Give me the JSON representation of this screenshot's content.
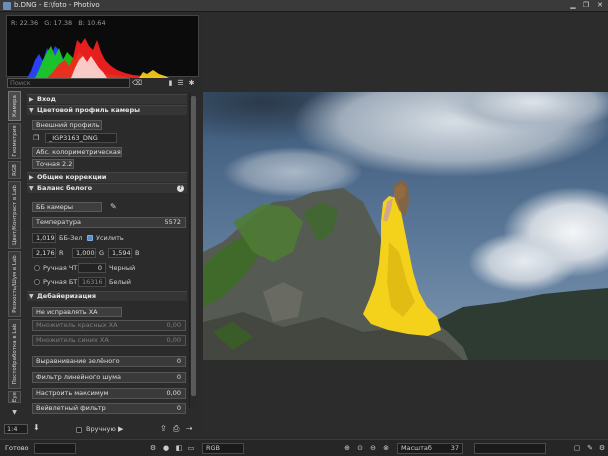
{
  "window": {
    "title": "b.DNG - E:\\foto - Photivo",
    "minimize_glyph": "▁",
    "maximize_glyph": "❐",
    "close_glyph": "✕"
  },
  "histogram": {
    "r_label": "R: 22.36",
    "g_label": "G: 17.38",
    "b_label": "B: 10.64"
  },
  "search": {
    "placeholder": "Поиск",
    "clear_icon": "⌫",
    "bookmark_icon": "▮",
    "menu_icon": "☰",
    "settings_icon": "✱"
  },
  "tabs": [
    {
      "label": "Камера"
    },
    {
      "label": "Геометрия"
    },
    {
      "label": "RGB"
    },
    {
      "label": "Цвет/Контраст в Lab"
    },
    {
      "label": "Резкость/Шум в Lab"
    },
    {
      "label": "Постобработка в Lab"
    },
    {
      "label": "Eye"
    }
  ],
  "tab_scroll_down": "▼",
  "sections": {
    "input": "Вход",
    "camera_profile": "Цветовой профиль камеры",
    "general": "Общие коррекции",
    "white_balance": "Баланс белого",
    "demosaic": "Дебайеризация"
  },
  "camera_profile": {
    "external_profile": "Внешний профиль",
    "file_name": "_IGP3163_DNG",
    "colorimetric": "Абс. колориметрическая",
    "exact": "Точная 2.2"
  },
  "white_balance": {
    "preset": "ББ камеры",
    "temperature_label": "Температура",
    "temperature_value": "5572",
    "green_value": "1,019",
    "green_label": "ББ-Зел",
    "amplify_label": "Усилить",
    "r_value": "2,176",
    "r_label": "R",
    "g_value": "1,000",
    "g_label": "G",
    "b_value": "1,594",
    "b_label": "B",
    "manual_black_label": "Ручная ЧТ",
    "manual_black_value": "0",
    "black_label": "Черный",
    "manual_white_label": "Ручная БТ",
    "manual_white_value": "16316",
    "white_label": "Белый"
  },
  "demosaic": {
    "ca_preset": "Не исправлять ХА",
    "red_mult_label": "Множитель красных ХА",
    "red_mult_value": "0,00",
    "blue_mult_label": "Множитель синих ХА",
    "blue_mult_value": "0,00",
    "green_eq_label": "Выравнивание зелёного",
    "green_eq_value": "0",
    "line_noise_label": "Фильтр линейного шума",
    "line_noise_value": "0",
    "max_label": "Настроить максимум",
    "max_value": "0,00",
    "wavelet_label": "Вейвлетный фильтр",
    "wavelet_value": "0"
  },
  "left_toolbar": {
    "zoom_ratio": "1:4",
    "manual_label": "Вручную",
    "play_icon": "▶"
  },
  "statusbar": {
    "status": "Готово",
    "color_space": "RGB",
    "scale_label": "Масштаб",
    "scale_value": "37"
  },
  "colors": {
    "panel_bg": "#2b2b2b",
    "accent": "#4f8fd0",
    "dress": "#f4d21c"
  }
}
